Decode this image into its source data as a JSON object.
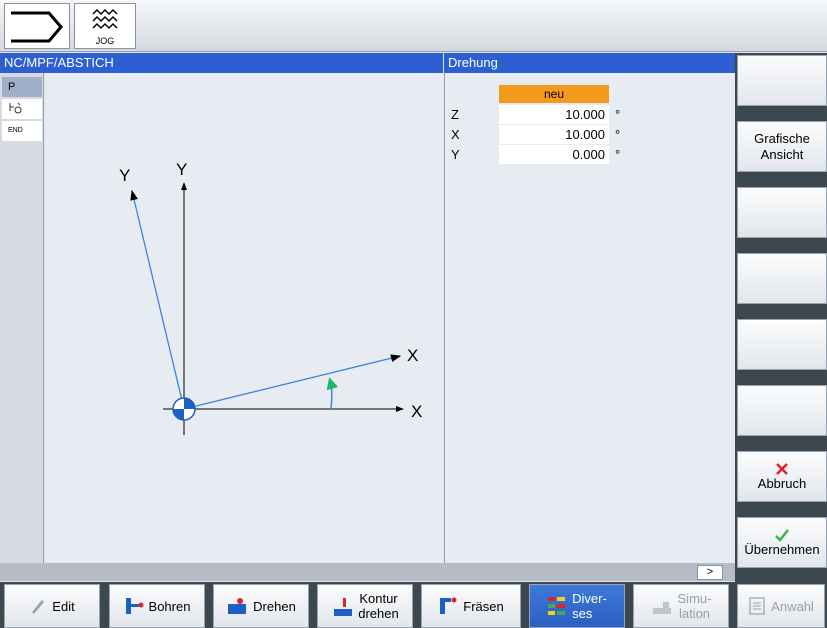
{
  "topbar": {
    "mode_label": "JOG"
  },
  "header": {
    "path": "NC/MPF/ABSTICH",
    "dialog_title": "Drehung"
  },
  "program_strip": {
    "p_label": "P",
    "end_label": "END"
  },
  "graphic": {
    "axis_y_orig": "Y",
    "axis_y_rot": "Y",
    "axis_x_rot": "X",
    "axis_x_orig": "X"
  },
  "params": {
    "header_value": "neu",
    "rows": [
      {
        "label": "Z",
        "value": "10.000",
        "unit": "°"
      },
      {
        "label": "X",
        "value": "10.000",
        "unit": "°"
      },
      {
        "label": "Y",
        "value": "0.000",
        "unit": "°"
      }
    ]
  },
  "status": {
    "more_label": ">"
  },
  "softkeys_right": {
    "grafische_line1": "Grafische",
    "grafische_line2": "Ansicht",
    "abbruch": "Abbruch",
    "uebernehmen": "Übernehmen"
  },
  "softkeys_bottom": {
    "edit": "Edit",
    "bohren": "Bohren",
    "drehen": "Drehen",
    "kontur_line1": "Kontur",
    "kontur_line2": "drehen",
    "fraesen": "Fräsen",
    "diverses_line1": "Diver-",
    "diverses_line2": "ses",
    "simulation_line1": "Simu-",
    "simulation_line2": "lation",
    "anwahl": "Anwahl"
  },
  "colors": {
    "header_blue": "#2e5fd2",
    "orange": "#f39a1c",
    "axis_blue": "#3b86d6",
    "arrow_green": "#1fb86a",
    "cancel_red": "#e0202a",
    "accept_green": "#3fb14a"
  }
}
